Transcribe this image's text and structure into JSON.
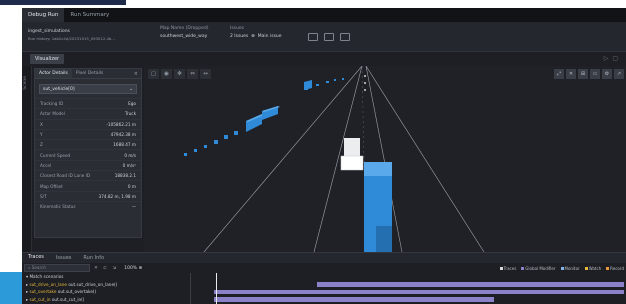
{
  "top_tabs": [
    "Debug Run",
    "Run Summary"
  ],
  "info_bar": {
    "scenario_name": "ingest_simulations",
    "scenario_sub": "Run history: 1ab2c4d/20231015_093012.4b...",
    "map_label": "Map Name (Dropped)",
    "map_value": "southwest_wide_way",
    "issues_label": "Issues",
    "issue_count": "2 Issues",
    "main_issue": "Main issue"
  },
  "visualizer_label": "Visualizer",
  "rail_label": "Scene",
  "panel": {
    "tabs": [
      "Actor Details",
      "Pixel Details"
    ],
    "close": "×",
    "actor_selected": "sut_vehicle[0]",
    "properties": [
      {
        "k": "Tracking ID",
        "v": "Ego"
      },
      {
        "k": "Actor Model",
        "v": "Truck"
      },
      {
        "k": "X",
        "v": "-105862.21 m"
      },
      {
        "k": "Y",
        "v": "47942.38 m"
      },
      {
        "k": "Z",
        "v": "1688.47 m"
      },
      {
        "k": "Current Speed",
        "v": "0 m/s"
      },
      {
        "k": "Accel",
        "v": "0 m/s²"
      },
      {
        "k": "Closest Road ID Lane ID",
        "v": "18838.2.1"
      },
      {
        "k": "Map Offset",
        "v": "0 m"
      },
      {
        "k": "S/T",
        "v": "374.82 m, 1.98 m"
      },
      {
        "k": "Kinematic Status",
        "v": "—"
      }
    ]
  },
  "viewport_tools_left": [
    "▢",
    "◉",
    "✥",
    "⇔",
    "↔"
  ],
  "viewport_tools_right": [
    "⤢",
    "✕",
    "⊞",
    "▭",
    "⚙",
    "↗"
  ],
  "bottom_tabs": [
    "Traces",
    "Issues",
    "Run Info"
  ],
  "trace_toolbar": {
    "search_placeholder": "Search",
    "zoom": "100% ⊕"
  },
  "legend": [
    {
      "label": "Traces",
      "color": "#d9d9d9"
    },
    {
      "label": "Global Modifier",
      "color": "#8c80c9"
    },
    {
      "label": "Monitor",
      "color": "#7fb3e6"
    },
    {
      "label": "Watch",
      "color": "#e6b93d"
    },
    {
      "label": "Record",
      "color": "#e69a3d"
    }
  ],
  "traces": [
    {
      "prefix": "▾ ",
      "name": "Match scenarios",
      "highlight": false,
      "bar_start": 0.0,
      "bar_end": 0.0
    },
    {
      "prefix": "▸ ",
      "name": "sut_drive_on_lane",
      "suffix": " out.sut_drive_on_lane()",
      "highlight": true,
      "bar_start": 0.29,
      "bar_end": 1.0
    },
    {
      "prefix": "▸ ",
      "name": "sut_overtake",
      "suffix": " out.sut_overtake()",
      "highlight": true,
      "bar_start": 0.05,
      "bar_end": 1.0
    },
    {
      "prefix": "▸ ",
      "name": "sut_cut_in",
      "suffix": " out.sut_cut_in()",
      "highlight": true,
      "bar_start": 0.05,
      "bar_end": 0.7
    }
  ],
  "colors": {
    "accent": "#2c9ad9",
    "trace_bar": "#8c80c9",
    "actor_blue": "#2f8bd8"
  }
}
